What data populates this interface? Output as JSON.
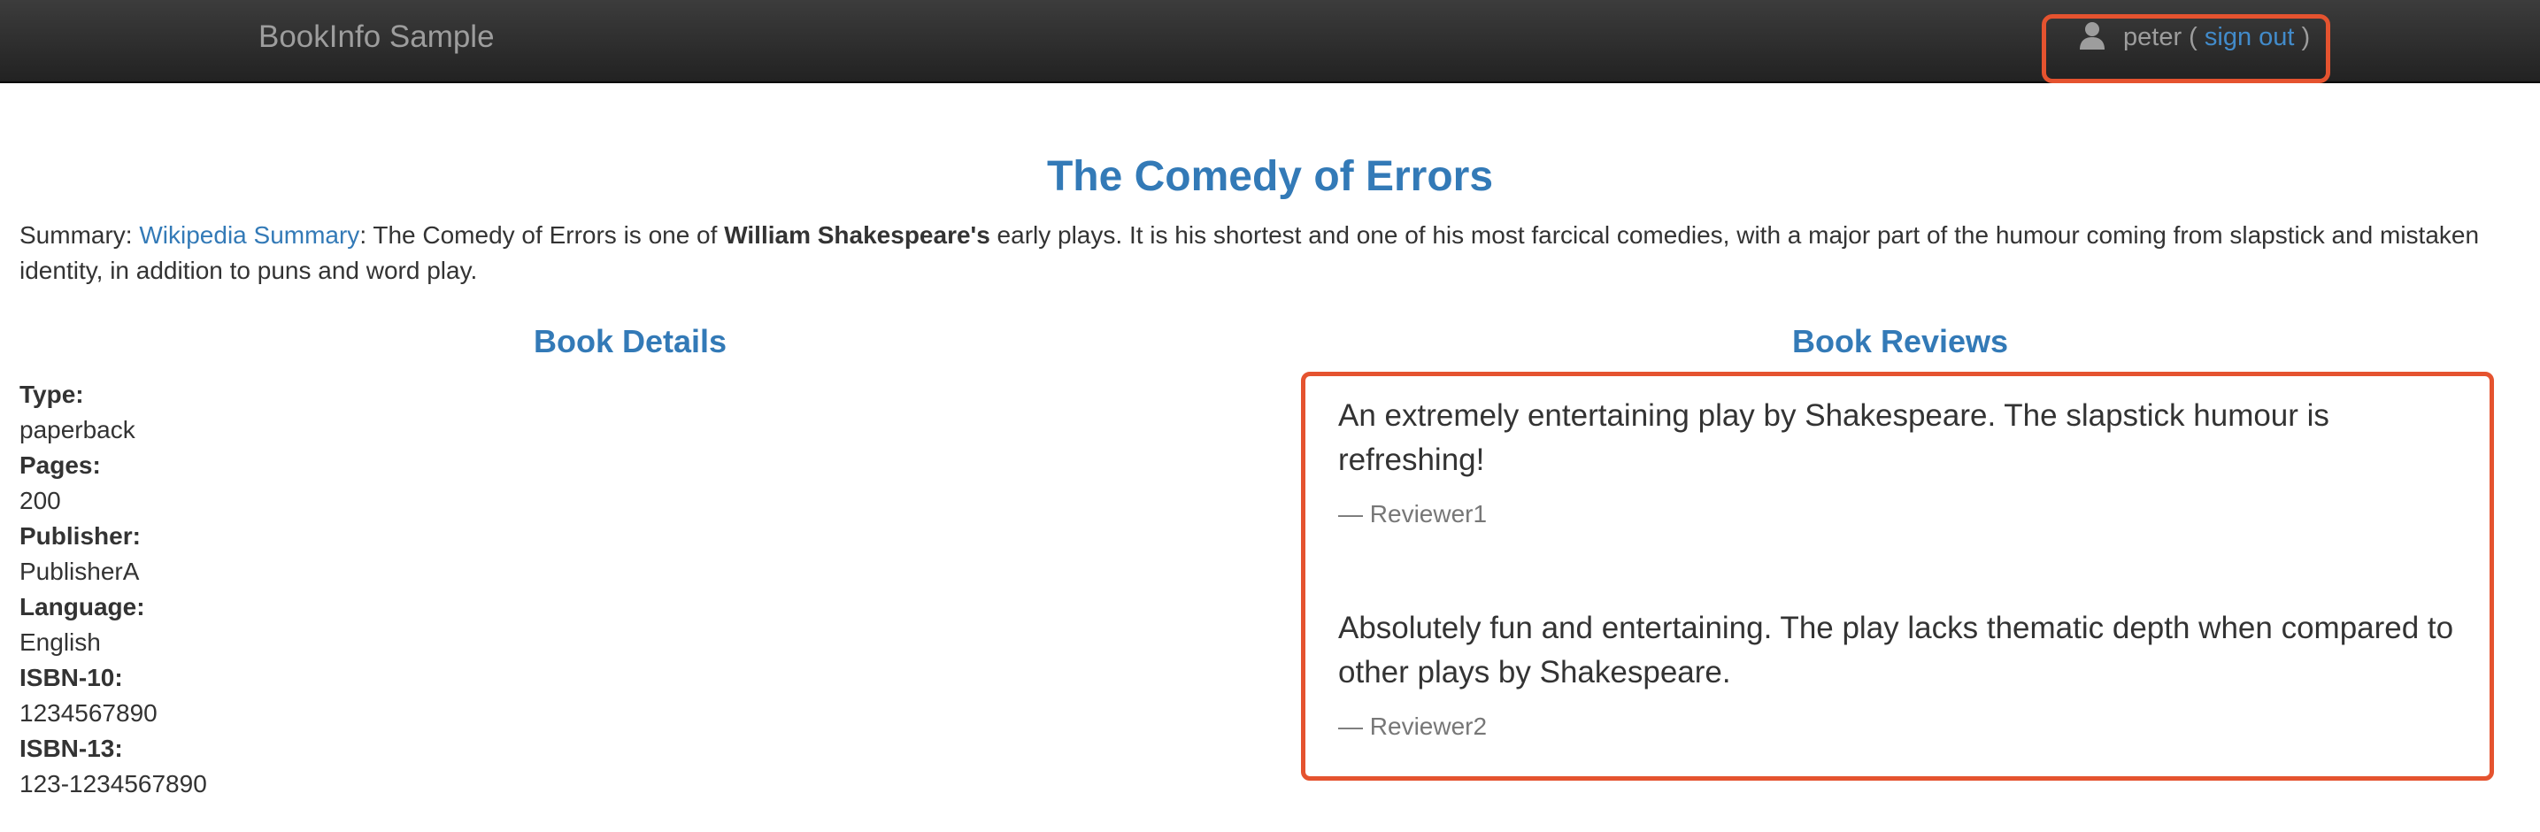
{
  "navbar": {
    "brand": "BookInfo Sample",
    "user": {
      "icon": "user-icon",
      "name": "peter",
      "open_paren": " ( ",
      "sign_out": "sign out",
      "close_paren": " )"
    }
  },
  "book": {
    "title": "The Comedy of Errors",
    "summary": {
      "label": "Summary: ",
      "link": "Wikipedia Summary",
      "text_1": ": The Comedy of Errors is one of ",
      "bold": "William Shakespeare's",
      "text_2": " early plays. It is his shortest and one of his most farcical comedies, with a major part of the humour coming from slapstick and mistaken identity, in addition to puns and word play."
    }
  },
  "details": {
    "heading": "Book Details",
    "fields": [
      {
        "label": "Type:",
        "value": "paperback"
      },
      {
        "label": "Pages:",
        "value": "200"
      },
      {
        "label": "Publisher:",
        "value": "PublisherA"
      },
      {
        "label": "Language:",
        "value": "English"
      },
      {
        "label": "ISBN-10:",
        "value": "1234567890"
      },
      {
        "label": "ISBN-13:",
        "value": "123-1234567890"
      }
    ]
  },
  "reviews": {
    "heading": "Book Reviews",
    "items": [
      {
        "text": "An extremely entertaining play by Shakespeare. The slapstick humour is refreshing!",
        "author": "— Reviewer1"
      },
      {
        "text": "Absolutely fun and entertaining. The play lacks thematic depth when compared to other plays by Shakespeare.",
        "author": "— Reviewer2"
      }
    ]
  },
  "colors": {
    "navbar_bg": "#222222",
    "brand": "#9d9d9d",
    "link": "#337ab7",
    "highlight_border": "#e5532f",
    "text": "#333333",
    "muted": "#777777"
  }
}
